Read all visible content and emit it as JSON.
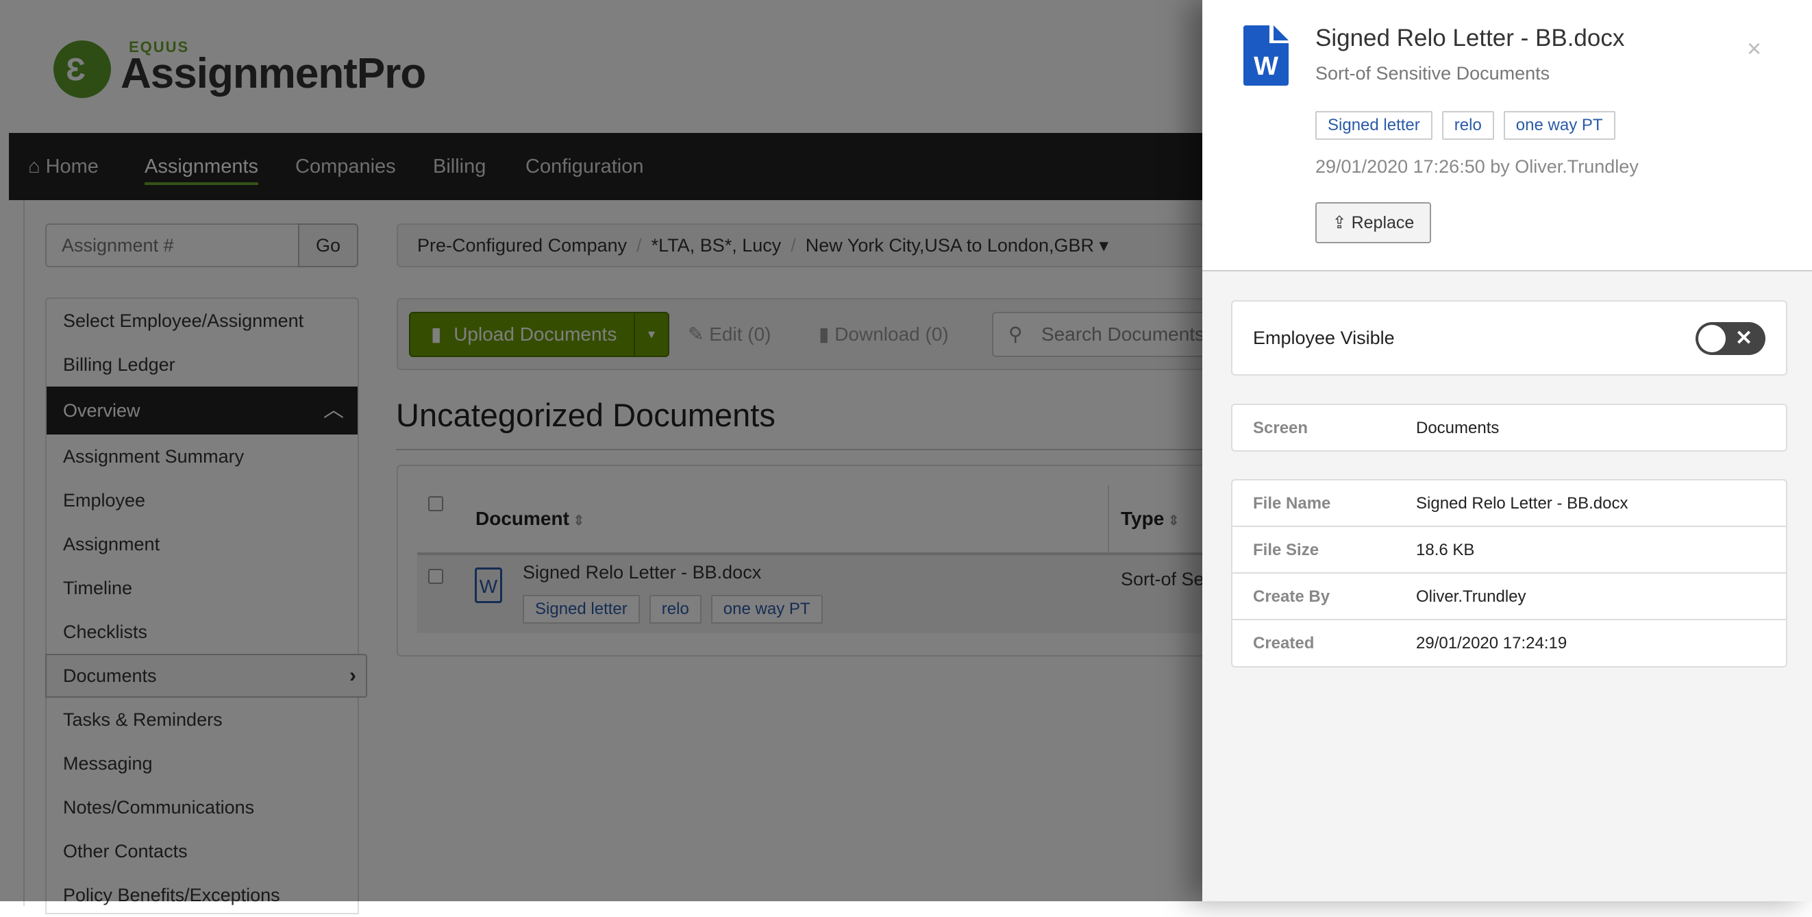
{
  "brand": {
    "top": "EQUUS",
    "name": "AssignmentPro",
    "color": "#5a9a2a"
  },
  "nav": {
    "items": [
      {
        "label": "Home",
        "icon": "home-icon"
      },
      {
        "label": "Assignments",
        "active": true
      },
      {
        "label": "Companies"
      },
      {
        "label": "Billing"
      },
      {
        "label": "Configuration"
      }
    ]
  },
  "assignment_search": {
    "placeholder": "Assignment #",
    "go": "Go"
  },
  "breadcrumb": [
    "Pre-Configured Company",
    "*LTA, BS*, Lucy",
    "New York City,USA to London,GBR"
  ],
  "sidebar": {
    "items": [
      "Select Employee/Assignment",
      "Billing Ledger",
      "Overview",
      "Assignment Summary",
      "Employee",
      "Assignment",
      "Timeline",
      "Checklists",
      "Documents",
      "Tasks & Reminders",
      "Messaging",
      "Notes/Communications",
      "Other Contacts",
      "Policy Benefits/Exceptions"
    ]
  },
  "toolbar": {
    "upload": "Upload Documents",
    "edit": "Edit (0)",
    "download": "Download (0)",
    "search_placeholder": "Search Documents"
  },
  "section_title": "Uncategorized Documents",
  "table": {
    "columns": [
      "Document",
      "Type"
    ],
    "rows": [
      {
        "name": "Signed Relo Letter - BB.docx",
        "tags": [
          "Signed letter",
          "relo",
          "one way PT"
        ],
        "type": "Sort-of Se"
      }
    ]
  },
  "panel": {
    "title": "Signed Relo Letter - BB.docx",
    "subtitle": "Sort-of Sensitive Documents",
    "tags": [
      "Signed letter",
      "relo",
      "one way PT"
    ],
    "modified": "29/01/2020 17:26:50 by Oliver.Trundley",
    "replace": "Replace",
    "employee_visible": {
      "label": "Employee Visible",
      "on": false
    },
    "screen": {
      "label": "Screen",
      "value": "Documents"
    },
    "details": [
      {
        "label": "File Name",
        "value": "Signed Relo Letter - BB.docx"
      },
      {
        "label": "File Size",
        "value": "18.6 KB"
      },
      {
        "label": "Create By",
        "value": "Oliver.Trundley"
      },
      {
        "label": "Created",
        "value": "29/01/2020 17:24:19"
      }
    ]
  }
}
